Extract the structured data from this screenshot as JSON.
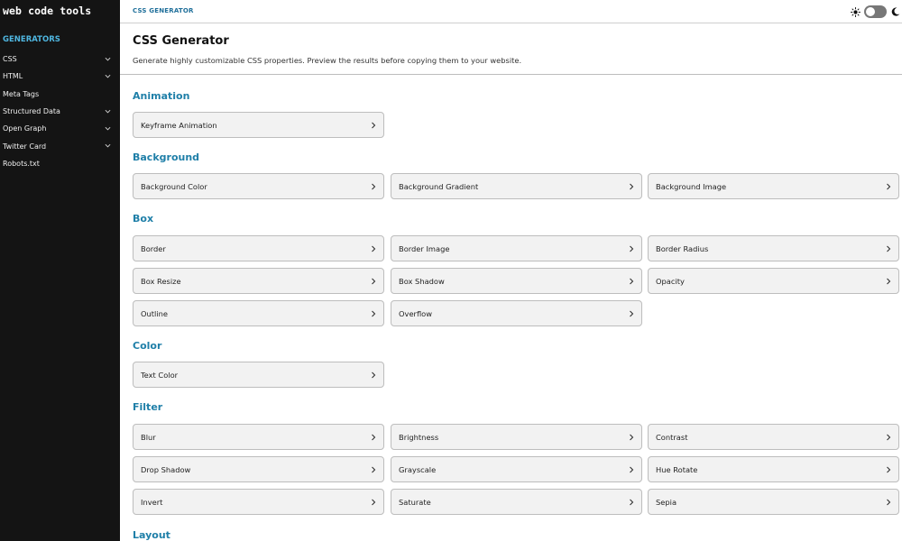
{
  "sidebar": {
    "brand": "web code tools",
    "section_heading": "GENERATORS",
    "items": [
      {
        "label": "CSS",
        "has_chevron": true
      },
      {
        "label": "HTML",
        "has_chevron": true
      },
      {
        "label": "Meta Tags",
        "has_chevron": false
      },
      {
        "label": "Structured Data",
        "has_chevron": true
      },
      {
        "label": "Open Graph",
        "has_chevron": true
      },
      {
        "label": "Twitter Card",
        "has_chevron": true
      },
      {
        "label": "Robots.txt",
        "has_chevron": false
      }
    ]
  },
  "topbar": {
    "breadcrumb": "CSS GENERATOR",
    "theme_icons": [
      "sun-icon",
      "moon-icon"
    ],
    "dark_mode": false
  },
  "header": {
    "title": "CSS Generator",
    "description": "Generate highly customizable CSS properties. Preview the results before copying them to your website."
  },
  "sections": [
    {
      "title": "Animation",
      "items": [
        "Keyframe Animation"
      ]
    },
    {
      "title": "Background",
      "items": [
        "Background Color",
        "Background Gradient",
        "Background Image"
      ]
    },
    {
      "title": "Box",
      "items": [
        "Border",
        "Border Image",
        "Border Radius",
        "Box Resize",
        "Box Shadow",
        "Opacity",
        "Outline",
        "Overflow"
      ]
    },
    {
      "title": "Color",
      "items": [
        "Text Color"
      ]
    },
    {
      "title": "Filter",
      "items": [
        "Blur",
        "Brightness",
        "Contrast",
        "Drop Shadow",
        "Grayscale",
        "Hue Rotate",
        "Invert",
        "Saturate",
        "Sepia"
      ]
    },
    {
      "title": "Layout",
      "items": []
    }
  ],
  "colors": {
    "sidebar_bg": "#141414",
    "accent": "#1f7fa8",
    "nav_heading": "#4fb6e0",
    "card_bg": "#f2f2f2"
  }
}
